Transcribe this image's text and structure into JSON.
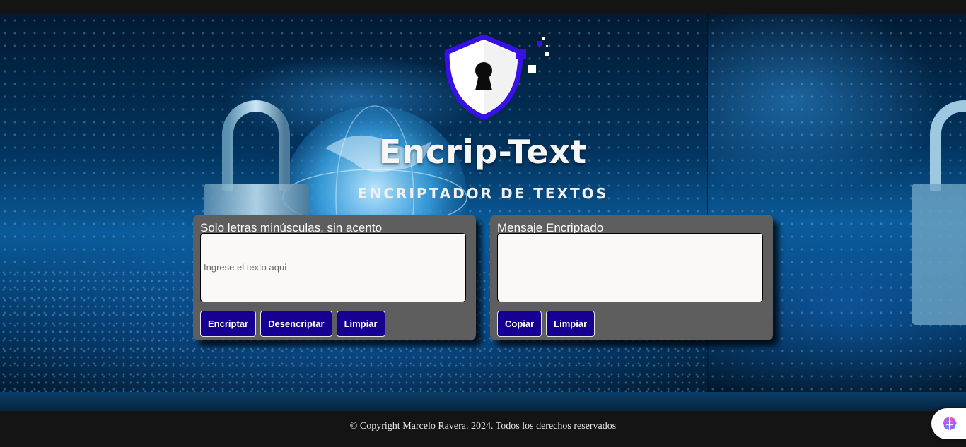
{
  "header": {
    "title": "Encrip-Text",
    "subtitle": "ENCRIPTADOR DE TEXTOS"
  },
  "input_card": {
    "label": "Solo letras minúsculas, sin acento",
    "placeholder": "Ingrese el texto aqui",
    "value": "",
    "buttons": {
      "encrypt": "Encriptar",
      "decrypt": "Desencriptar",
      "clear": "Limpiar"
    }
  },
  "output_card": {
    "label": "Mensaje Encriptado",
    "value": "",
    "buttons": {
      "copy": "Copiar",
      "clear": "Limpiar"
    }
  },
  "footer": {
    "copyright": "© Copyright Marcelo Ravera. 2024. Todos los derechos reservados"
  },
  "icons": {
    "logo": "shield-keyhole-icon",
    "extension": "brain-icon"
  },
  "colors": {
    "button_bg": "#150093",
    "card_bg": "#5e5e5e",
    "shield_stroke": "#3a10e8",
    "page_bg": "#141414"
  }
}
